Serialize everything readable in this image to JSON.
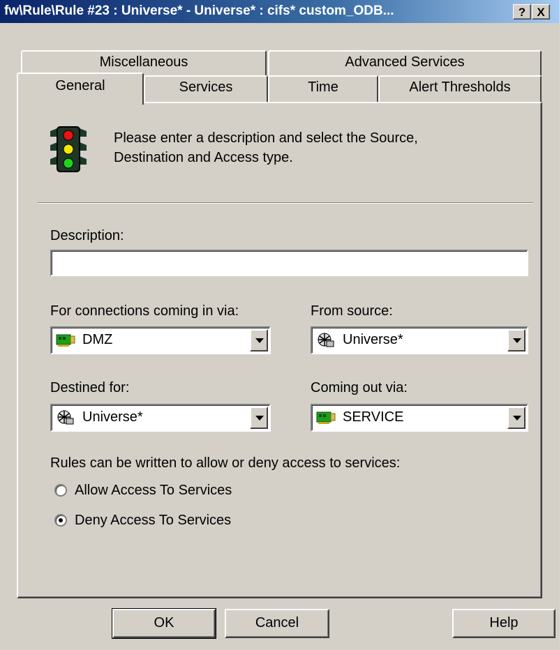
{
  "window": {
    "title": "fw\\Rule\\Rule #23 : Universe* - Universe* : cifs* custom_ODB...",
    "help_btn": "?",
    "close_btn": "X"
  },
  "tabs_row1": [
    {
      "label": "Miscellaneous"
    },
    {
      "label": "Advanced Services"
    }
  ],
  "tabs_row2": [
    {
      "label": "General",
      "active": true
    },
    {
      "label": "Services"
    },
    {
      "label": "Time"
    },
    {
      "label": "Alert Thresholds"
    }
  ],
  "header": {
    "icon": "traffic-light-icon",
    "text_line1": "Please enter a description and select the Source,",
    "text_line2": "Destination and Access type."
  },
  "form": {
    "description_label": "Description:",
    "description_value": "",
    "incoming_label": "For connections coming in via:",
    "incoming_value": "DMZ",
    "incoming_icon": "network-card-icon",
    "source_label": "From source:",
    "source_value": "Universe*",
    "source_icon": "globe-network-icon",
    "destined_label": "Destined for:",
    "destined_value": "Universe*",
    "destined_icon": "globe-network-icon",
    "outgoing_label": "Coming out via:",
    "outgoing_value": "SERVICE",
    "outgoing_icon": "network-card-icon",
    "access_prompt": "Rules can be written to allow or deny access to services:",
    "allow_label": "Allow Access To Services",
    "deny_label": "Deny Access To Services",
    "selected_access": "deny"
  },
  "buttons": {
    "ok": "OK",
    "cancel": "Cancel",
    "help": "Help"
  },
  "colors": {
    "titlebar_start": "#0a246a",
    "titlebar_end": "#a6caf0",
    "face": "#d4d0c8"
  }
}
